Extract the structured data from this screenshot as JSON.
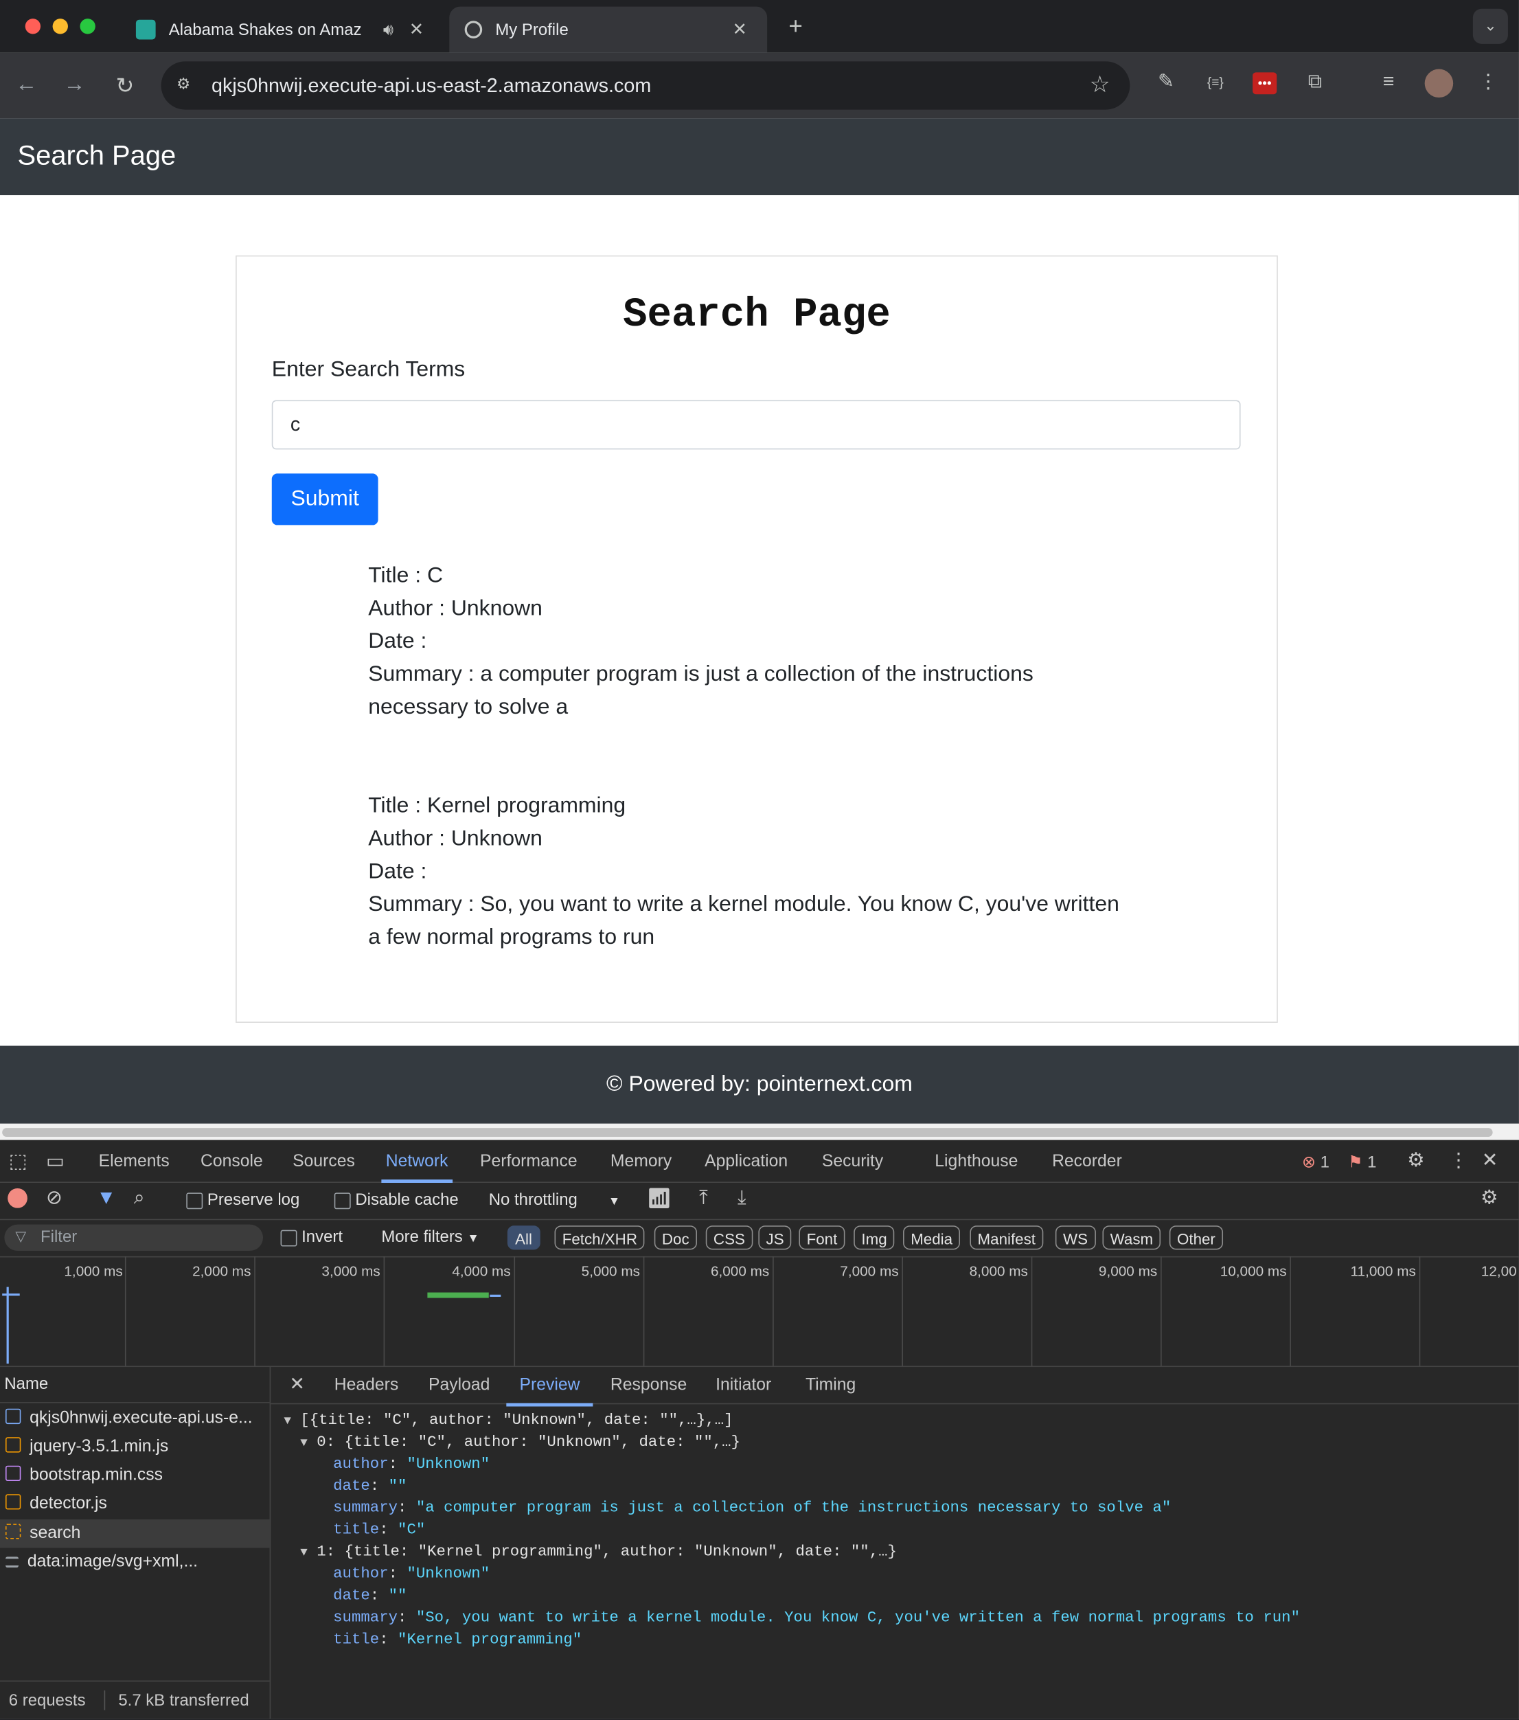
{
  "browser": {
    "tabs": [
      {
        "title": "Alabama Shakes on Amaz"
      },
      {
        "title": "My Profile"
      }
    ],
    "address": "qkjs0hnwij.execute-api.us-east-2.amazonaws.com"
  },
  "page": {
    "navbar_brand": "Search Page",
    "heading": "Search Page",
    "search_label": "Enter Search Terms",
    "search_value": "c",
    "submit_label": "Submit",
    "results": [
      {
        "title": "Title : C",
        "author": "Author : Unknown",
        "date": "Date :",
        "summary_line1": "Summary : a computer program is just a collection of the instructions",
        "summary_line2": "necessary to solve a"
      },
      {
        "title": "Title : Kernel programming",
        "author": "Author : Unknown",
        "date": "Date :",
        "summary_line1": "Summary : So, you want to write a kernel module. You know C, you've written",
        "summary_line2": "a few normal programs to run"
      }
    ],
    "footer": "© Powered by: pointernext.com"
  },
  "devtools": {
    "tabs": [
      "Elements",
      "Console",
      "Sources",
      "Network",
      "Performance",
      "Memory",
      "Application",
      "Security",
      "Lighthouse",
      "Recorder"
    ],
    "active_tab": "Network",
    "error_count": "1",
    "issue_count": "1",
    "preserve_log": "Preserve log",
    "disable_cache": "Disable cache",
    "throttling": "No throttling",
    "filter_placeholder": "Filter",
    "invert": "Invert",
    "more_filters": "More filters",
    "type_filters": [
      "All",
      "Fetch/XHR",
      "Doc",
      "CSS",
      "JS",
      "Font",
      "Img",
      "Media",
      "Manifest",
      "WS",
      "Wasm",
      "Other"
    ],
    "timeline_ticks": [
      "1,000 ms",
      "2,000 ms",
      "3,000 ms",
      "4,000 ms",
      "5,000 ms",
      "6,000 ms",
      "7,000 ms",
      "8,000 ms",
      "9,000 ms",
      "10,000 ms",
      "11,000 ms",
      "12,00"
    ],
    "name_header": "Name",
    "requests": [
      {
        "name": "qkjs0hnwij.execute-api.us-e...",
        "type": "doc"
      },
      {
        "name": "jquery-3.5.1.min.js",
        "type": "script"
      },
      {
        "name": "bootstrap.min.css",
        "type": "css"
      },
      {
        "name": "detector.js",
        "type": "script"
      },
      {
        "name": "search",
        "type": "fetch",
        "selected": true
      },
      {
        "name": "data:image/svg+xml,...",
        "type": "other"
      }
    ],
    "status_requests": "6 requests",
    "status_transferred": "5.7 kB transferred",
    "detail_tabs": [
      "Headers",
      "Payload",
      "Preview",
      "Response",
      "Initiator",
      "Timing"
    ],
    "active_detail_tab": "Preview",
    "preview": {
      "root": "[{title: \"C\", author: \"Unknown\", date: \"\",…},…]",
      "item0": "0: {title: \"C\", author: \"Unknown\", date: \"\",…}",
      "item1": "1: {title: \"Kernel programming\", author: \"Unknown\", date: \"\",…}",
      "author_key": "author",
      "date_key": "date",
      "summary_key": "summary",
      "title_key": "title",
      "v0_author": "\"Unknown\"",
      "v0_date": "\"\"",
      "v0_summary": "\"a computer program is just a collection of the instructions necessary to solve a\"",
      "v0_title": "\"C\"",
      "v1_author": "\"Unknown\"",
      "v1_date": "\"\"",
      "v1_summary": "\"So, you want to write a kernel module. You know C, you've written a few normal programs to run\"",
      "v1_title": "\"Kernel programming\""
    }
  },
  "colors": {
    "primary_button": "#0d6efd",
    "navbar": "#343a40",
    "devtools_accent": "#7cacf8"
  }
}
